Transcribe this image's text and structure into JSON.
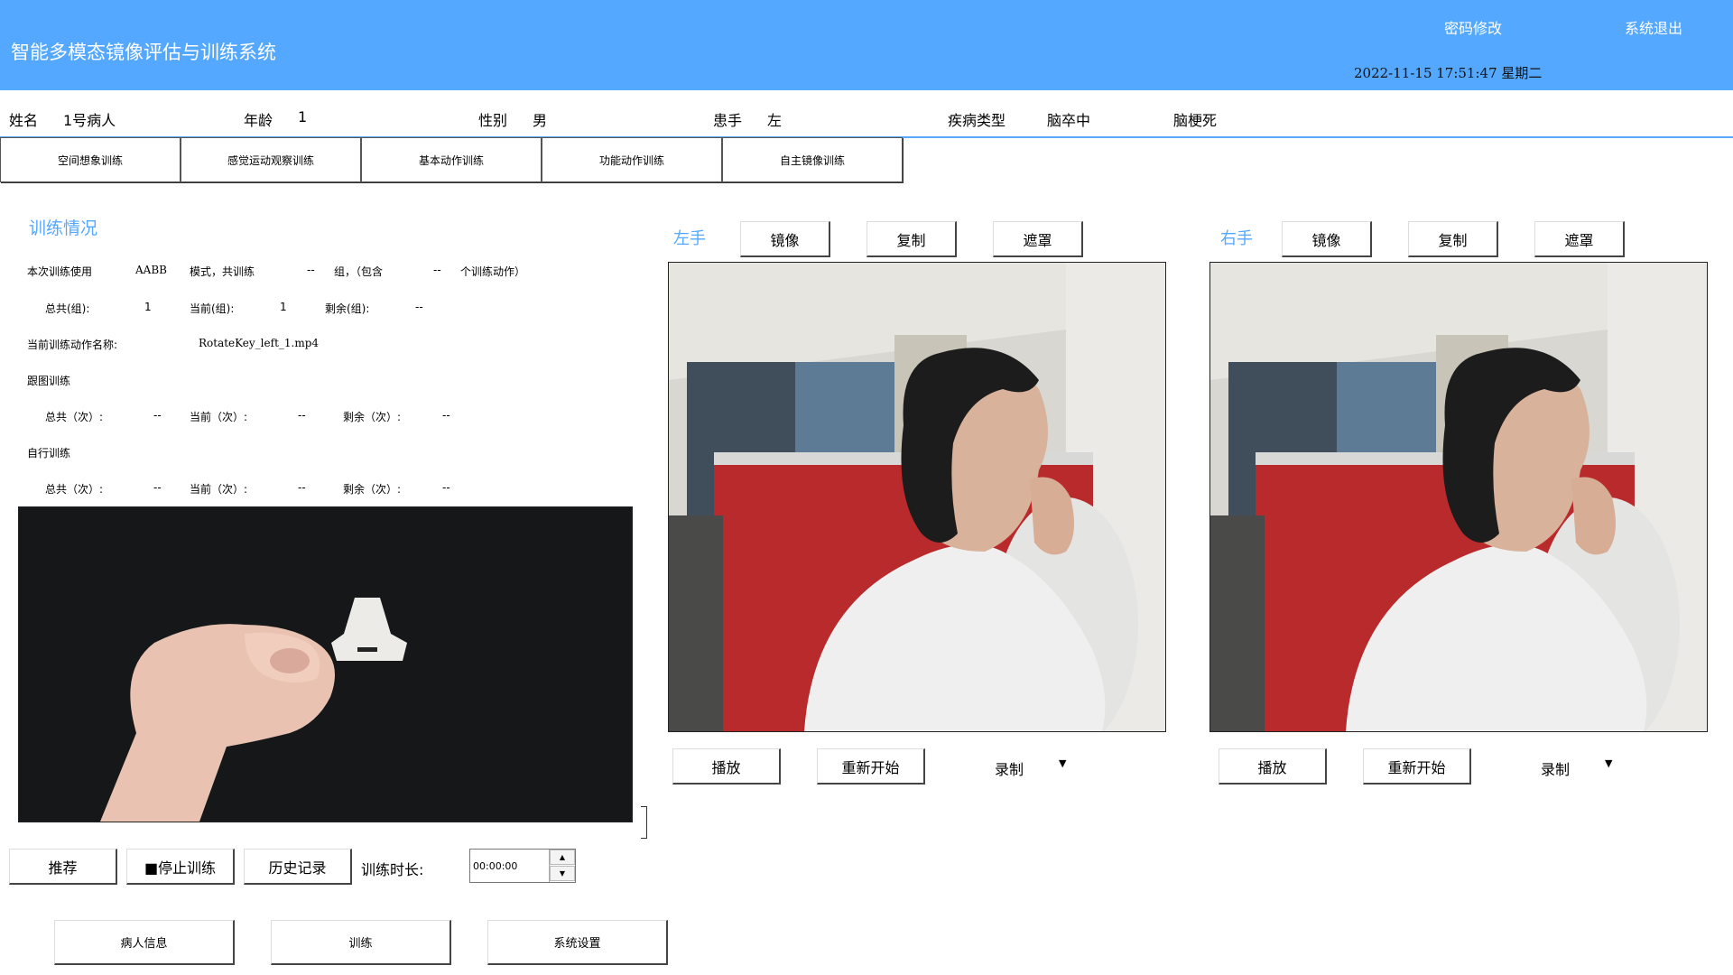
{
  "header": {
    "title": "智能多模态镜像评估与训练系统",
    "change_password": "密码修改",
    "exit": "系统退出",
    "datetime": "2022-11-15 17:51:47 星期二",
    "bg_color": "#55a8ff"
  },
  "patient": {
    "name_label": "姓名",
    "name": "1号病人",
    "age_label": "年龄",
    "age": "1",
    "gender_label": "性别",
    "gender": "男",
    "hand_label": "患手",
    "hand": "左",
    "disease_label": "疾病类型",
    "disease": "脑卒中",
    "disease_sub": "脑梗死"
  },
  "tabs": [
    "空间想象训练",
    "感觉运动观察训练",
    "基本动作训练",
    "功能动作训练",
    "自主镜像训练"
  ],
  "training": {
    "title": "训练情况",
    "row1": {
      "a": "本次训练使用",
      "mode": "AABB",
      "b": "模式，共训练",
      "groups": "--",
      "c": "组，（包含",
      "actions": "--",
      "d": "个训练动作）"
    },
    "row2": {
      "total_label": "总共(组):",
      "total": "1",
      "current_label": "当前(组):",
      "current": "1",
      "remain_label": "剩余(组):",
      "remain": "--"
    },
    "action_label": "当前训练动作名称:",
    "action_name": "RotateKey_left_1.mp4",
    "follow_label": "跟图训练",
    "follow": {
      "total_label": "总共（次）:",
      "total": "--",
      "current_label": "当前（次）:",
      "current": "--",
      "remain_label": "剩余（次）:",
      "remain": "--"
    },
    "self_label": "自行训练",
    "self": {
      "total_label": "总共（次）:",
      "total": "--",
      "current_label": "当前（次）:",
      "current": "--",
      "remain_label": "剩余（次）:",
      "remain": "--"
    }
  },
  "controls": {
    "recommend": "推荐",
    "stop": "■停止训练",
    "history": "历史记录",
    "duration_label": "训练时长:",
    "duration_value": "00:00:00"
  },
  "bottom_nav": [
    "病人信息",
    "训练",
    "系统设置"
  ],
  "left_panel": {
    "label": "左手",
    "mirror": "镜像",
    "copy": "复制",
    "mask": "遮罩",
    "play": "播放",
    "restart": "重新开始",
    "record": "录制"
  },
  "right_panel": {
    "label": "右手",
    "mirror": "镜像",
    "copy": "复制",
    "mask": "遮罩",
    "play": "播放",
    "restart": "重新开始",
    "record": "录制"
  },
  "icons": {
    "dropdown": "caret-down-icon",
    "spin_up": "spin-up-icon",
    "spin_down": "spin-down-icon"
  }
}
